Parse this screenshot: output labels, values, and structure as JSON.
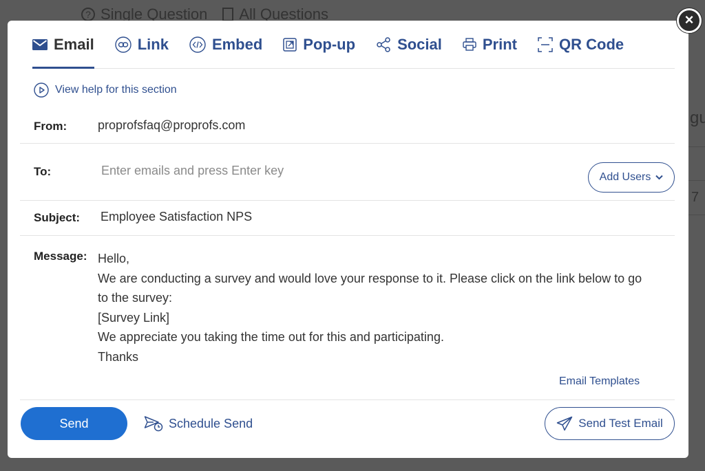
{
  "background": {
    "tabs": [
      {
        "label": "Single Question",
        "icon": "question-circle-icon"
      },
      {
        "label": "All Questions",
        "icon": "document-icon"
      }
    ],
    "fragment_a": "gu",
    "fragment_b": "7"
  },
  "modal": {
    "close_icon": "×",
    "tabs": [
      {
        "label": "Email",
        "icon": "envelope-icon",
        "active": true
      },
      {
        "label": "Link",
        "icon": "link-icon"
      },
      {
        "label": "Embed",
        "icon": "embed-code-icon"
      },
      {
        "label": "Pop-up",
        "icon": "popup-icon"
      },
      {
        "label": "Social",
        "icon": "share-icon"
      },
      {
        "label": "Print",
        "icon": "printer-icon"
      },
      {
        "label": "QR Code",
        "icon": "qr-code-icon"
      }
    ],
    "help_link": "View help for this section",
    "from": {
      "label": "From:",
      "value": "proprofsfaq@proprofs.com"
    },
    "to": {
      "label": "To:",
      "placeholder": "Enter emails and press Enter key",
      "add_users": "Add Users"
    },
    "subject": {
      "label": "Subject:",
      "value": "Employee Satisfaction NPS"
    },
    "message": {
      "label": "Message:",
      "lines": [
        "Hello,",
        "We are conducting a survey and would love your response to it. Please click on the link below to go",
        "to the survey:",
        "[Survey Link]",
        "We appreciate you taking the time out for this and participating.",
        "Thanks"
      ]
    },
    "email_templates": "Email Templates",
    "footer": {
      "send": "Send",
      "schedule_send": "Schedule Send",
      "send_test": "Send Test Email"
    },
    "colors": {
      "accent": "#2f4f8f",
      "primary_button": "#1f6fd1",
      "overlay": "#5a5a5a"
    }
  }
}
